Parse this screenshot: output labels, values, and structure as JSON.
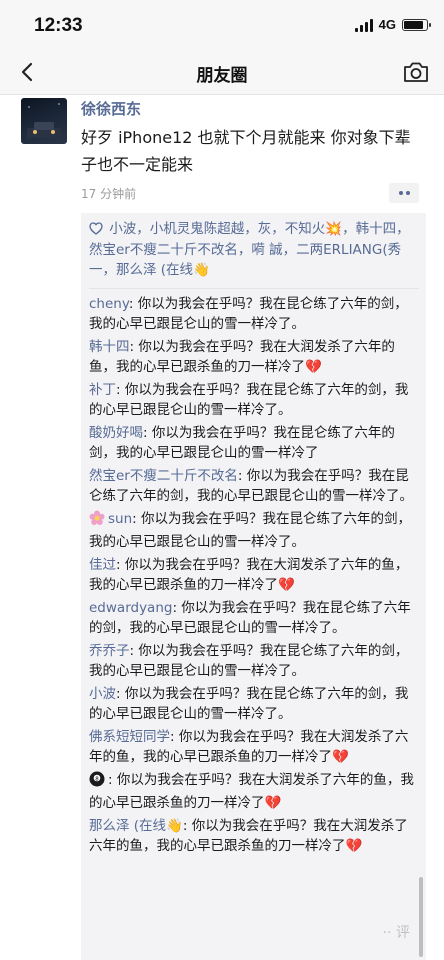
{
  "status_bar": {
    "time": "12:33",
    "network": "4G",
    "battery_level": 0.9
  },
  "nav": {
    "title": "朋友圈",
    "back_icon": "chevron-left-icon",
    "camera_icon": "camera-icon"
  },
  "post": {
    "author": "徐徐西东",
    "text": "好歹 iPhone12 也就下个月就能来 你对象下辈子也不一定能来",
    "time": "17 分钟前"
  },
  "likes": {
    "names": "小波，小机灵鬼陈超越，灰，不知火💥，韩十四，然宝er不瘦二十斤不改名，嗬 誠，二两ERLIANG(秀一，那么泽 (在线👋"
  },
  "comments": [
    {
      "name": "cheny",
      "text": ": 你以为我会在乎吗？我在昆仑练了六年的剑，我的心早已跟昆仑山的雪一样冷了。"
    },
    {
      "name": "韩十四",
      "text": ": 你以为我会在乎吗？我在大润发杀了六年的鱼，我的心早已跟杀鱼的刀一样冷了💔"
    },
    {
      "name": "补丁",
      "text": ": 你以为我会在乎吗？我在昆仑练了六年的剑，我的心早已跟昆仑山的雪一样冷了。"
    },
    {
      "name": "酸奶好喝",
      "text": ": 你以为我会在乎吗？我在昆仑练了六年的剑，我的心早已跟昆仑山的雪一样冷了"
    },
    {
      "name": "然宝er不瘦二十斤不改名",
      "text": ": 你以为我会在乎吗？我在昆仑练了六年的剑，我的心早已跟昆仑山的雪一样冷了。"
    },
    {
      "name": "sun",
      "text": ": 你以为我会在乎吗？我在昆仑练了六年的剑，我的心早已跟昆仑山的雪一样冷了。",
      "icon": "flower-icon"
    },
    {
      "name": "佳过",
      "text": ": 你以为我会在乎吗？我在大润发杀了六年的鱼，我的心早已跟杀鱼的刀一样冷了💔"
    },
    {
      "name": "edwardyang",
      "text": ": 你以为我会在乎吗？我在昆仑练了六年的剑，我的心早已跟昆仑山的雪一样冷了。"
    },
    {
      "name": "乔乔子",
      "text": ": 你以为我会在乎吗？我在昆仑练了六年的剑，我的心早已跟昆仑山的雪一样冷了。"
    },
    {
      "name": "小波",
      "text": ": 你以为我会在乎吗？我在昆仑练了六年的剑，我的心早已跟昆仑山的雪一样冷了。"
    },
    {
      "name": "佛系短短同学",
      "text": ": 你以为我会在乎吗？我在大润发杀了六年的鱼，我的心早已跟杀鱼的刀一样冷了💔"
    },
    {
      "name": "",
      "text": ": 你以为我会在乎吗？我在大润发杀了六年的鱼，我的心早已跟杀鱼的刀一样冷了💔",
      "icon": "eight-ball-icon"
    },
    {
      "name": "那么泽 (在线👋",
      "text": ": 你以为我会在乎吗？我在大润发杀了六年的鱼，我的心早已跟杀鱼的刀一样冷了💔"
    }
  ]
}
